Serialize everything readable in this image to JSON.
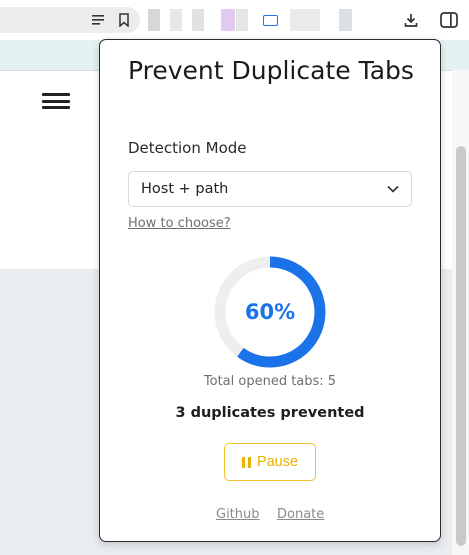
{
  "popup": {
    "title": "Prevent Duplicate Tabs",
    "detection_label": "Detection Mode",
    "detection_value": "Host + path",
    "help_link": "How to choose?",
    "gauge_percent": 60,
    "gauge_label": "60%",
    "total_opened": "Total opened tabs: 5",
    "duplicates_prevented": "3 duplicates prevented",
    "pause_label": "Pause",
    "footer": {
      "github": "Github",
      "donate": "Donate"
    }
  },
  "toolbar": {
    "icons": [
      "tab-search-icon",
      "bookmark-icon",
      "prevent-duplicate-tabs-extension-icon",
      "download-icon",
      "side-panel-icon"
    ],
    "extension_slot_colors": [
      "#d8d8d8",
      "#e6e6e6",
      "#e2e2e2",
      "#e2caef",
      "#e6e6e6",
      "#eaeaea",
      "#dcdfe3"
    ]
  },
  "colors": {
    "accent": "#1a73e8",
    "gauge_track": "#eeeeee",
    "pause": "#e8b100",
    "bookmark_bar": "#e4f2f3"
  }
}
